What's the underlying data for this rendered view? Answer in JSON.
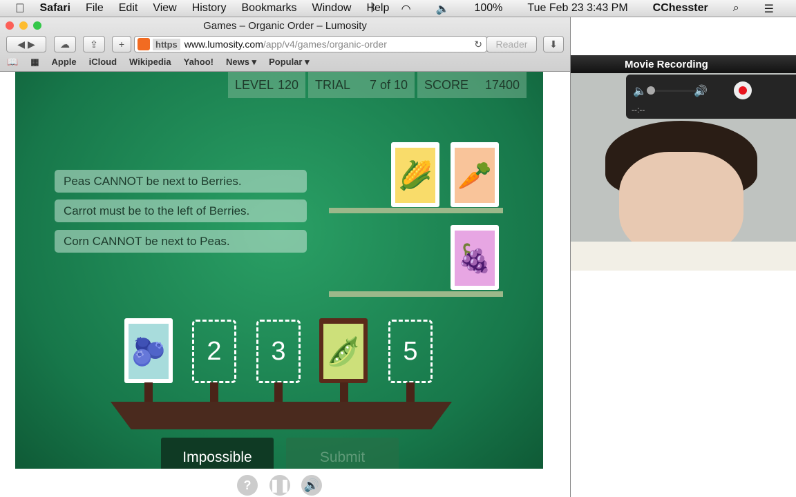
{
  "menubar": {
    "apple": "",
    "app": "Safari",
    "items": [
      "File",
      "Edit",
      "View",
      "History",
      "Bookmarks",
      "Window",
      "Help"
    ],
    "battery": "100%",
    "datetime": "Tue Feb 23  3:43 PM",
    "user": "CChesster"
  },
  "browser": {
    "title": "Games – Organic Order – Lumosity",
    "https": "https",
    "url_domain": "www.lumosity.com",
    "url_path": "/app/v4/games/organic-order",
    "reader": "Reader",
    "bookmarks": [
      "Apple",
      "iCloud",
      "Wikipedia",
      "Yahoo!",
      "News ▾",
      "Popular ▾"
    ]
  },
  "game": {
    "level_label": "LEVEL",
    "level": "120",
    "trial_label": "TRIAL",
    "trial": "7 of 10",
    "score_label": "SCORE",
    "score": "17400",
    "rules": [
      "Peas CANNOT be next to Berries.",
      "Carrot must be to the left of Berries.",
      "Corn CANNOT be next to Peas."
    ],
    "shelf_items": [
      "corn",
      "carrot",
      "grapes"
    ],
    "slots": [
      "berries",
      "2",
      "3",
      "peas",
      "5"
    ],
    "impossible": "Impossible",
    "submit": "Submit"
  },
  "recording": {
    "title": "Movie Recording",
    "time": "--:--"
  },
  "colors": {
    "game_green": "#1e8a55",
    "record_red": "#e8141e"
  }
}
